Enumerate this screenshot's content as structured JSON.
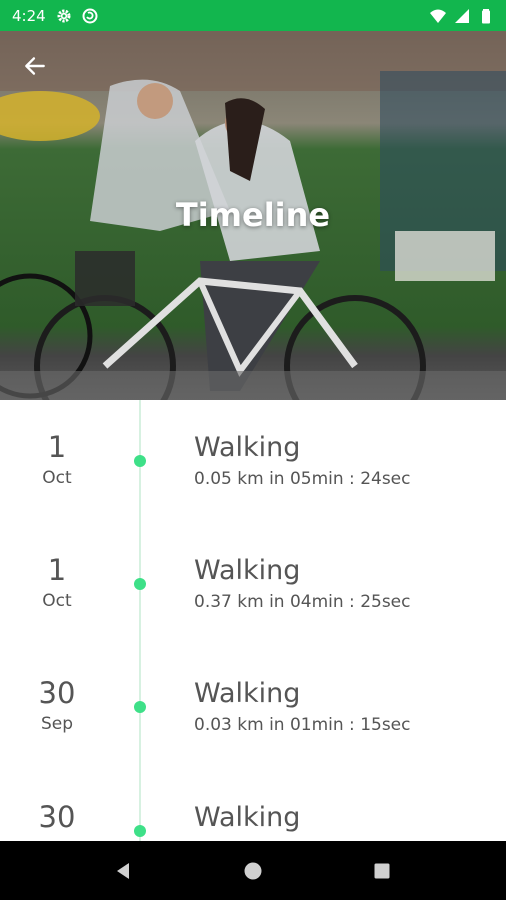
{
  "status_bar": {
    "time": "4:24",
    "left_icons": [
      "gear-icon",
      "sync-icon"
    ],
    "right_icons": [
      "wifi-icon",
      "signal-icon",
      "battery-icon"
    ],
    "color": "#12b64e"
  },
  "header": {
    "title": "Timeline",
    "back_icon": "arrow-left-icon"
  },
  "timeline": {
    "accent_color": "#3ee088",
    "entries": [
      {
        "day": "1",
        "month": "Oct",
        "title": "Walking",
        "detail": "0.05 km in 05min : 24sec"
      },
      {
        "day": "1",
        "month": "Oct",
        "title": "Walking",
        "detail": "0.37 km in 04min : 25sec"
      },
      {
        "day": "30",
        "month": "Sep",
        "title": "Walking",
        "detail": "0.03 km in 01min : 15sec"
      },
      {
        "day": "30",
        "month": "",
        "title": "Walking",
        "detail": ""
      }
    ]
  },
  "nav_bar": {
    "buttons": [
      "back-triangle-icon",
      "home-circle-icon",
      "recents-square-icon"
    ]
  }
}
